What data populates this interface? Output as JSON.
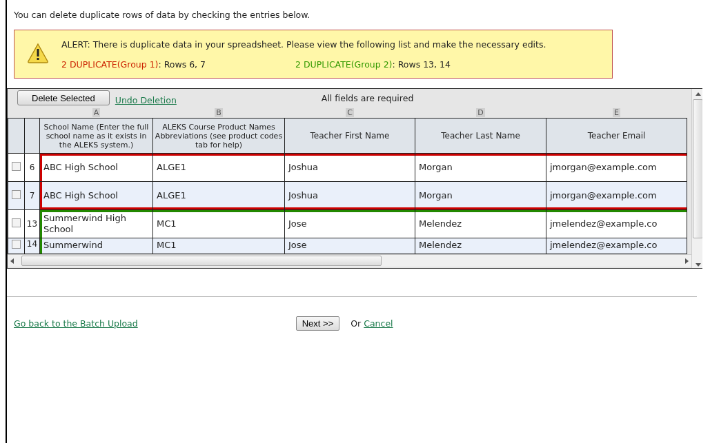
{
  "intro": "You can delete duplicate rows of data by checking the entries below.",
  "alert": {
    "message": "ALERT: There is duplicate data in your spreadsheet. Please view the following list and make the necessary edits.",
    "groups": [
      {
        "label": "2 DUPLICATE(Group 1)",
        "rows": ": Rows 6, 7",
        "color": "#cc2200"
      },
      {
        "label": "2 DUPLICATE(Group 2)",
        "rows": ": Rows 13, 14",
        "color": "#339900"
      }
    ]
  },
  "toolbar": {
    "delete_button": "Delete Selected",
    "undo_link": "Undo Deletion",
    "note": "All fields are required"
  },
  "table": {
    "column_letters": [
      "A",
      "B",
      "C",
      "D",
      "E"
    ],
    "columns": [
      "School Name (Enter the full school name as it exists in the ALEKS system.)",
      "ALEKS Course Product Names Abbreviations (see product codes tab for help)",
      "Teacher First Name",
      "Teacher Last Name",
      "Teacher Email"
    ],
    "rows": [
      {
        "number": "6",
        "checked": false,
        "color": "#cc0000",
        "cells": [
          "ABC High School",
          "ALGE1",
          "Joshua",
          "Morgan",
          "jmorgan@example.com"
        ]
      },
      {
        "number": "7",
        "checked": false,
        "color": "#cc0000",
        "cells": [
          "ABC High School",
          "ALGE1",
          "Joshua",
          "Morgan",
          "jmorgan@example.com"
        ]
      },
      {
        "number": "13",
        "checked": false,
        "color": "#228800",
        "cells": [
          "Summerwind High School",
          "MC1",
          "Jose",
          "Melendez",
          "jmelendez@example.co"
        ]
      },
      {
        "number": "14",
        "checked": false,
        "color": "#228800",
        "cells": [
          "Summerwind",
          "MC1",
          "Jose",
          "Melendez",
          "jmelendez@example.co"
        ]
      }
    ]
  },
  "footer": {
    "back_link": "Go back to the Batch Upload",
    "next_button": "Next >>",
    "or_text": "Or",
    "cancel_link": "Cancel"
  }
}
